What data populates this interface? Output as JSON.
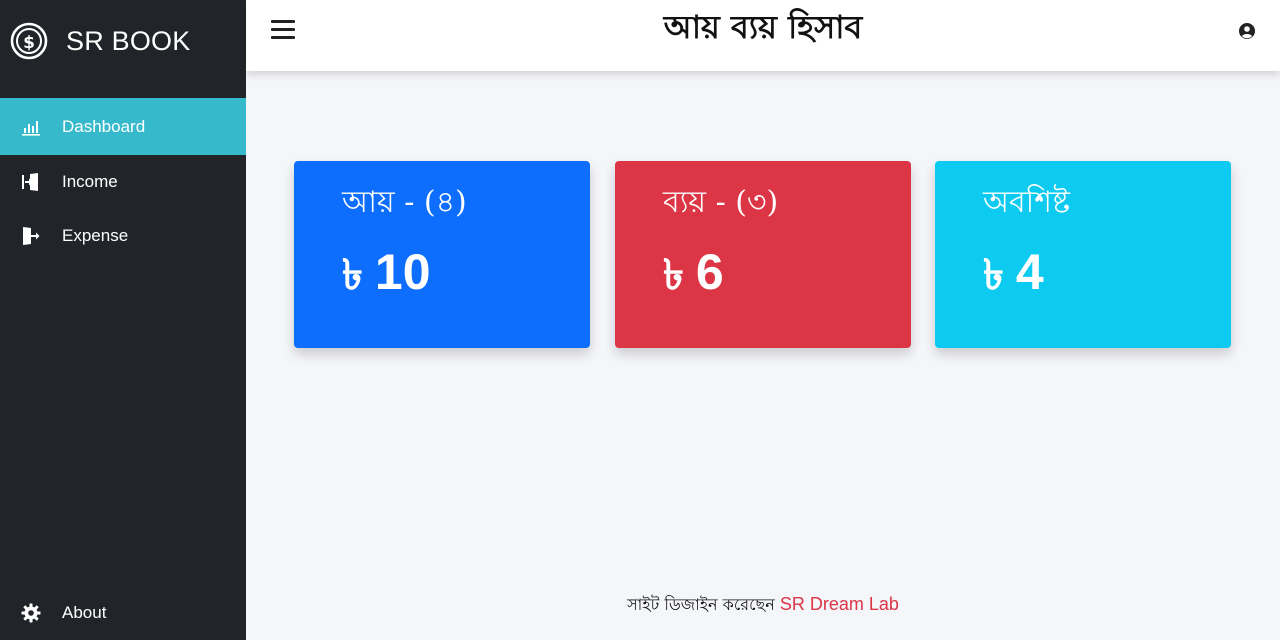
{
  "brand": {
    "name": "SR BOOK",
    "icon": "dollar-circle-icon"
  },
  "sidebar": {
    "items": [
      {
        "label": "Dashboard",
        "icon": "bar-chart-icon",
        "active": true
      },
      {
        "label": "Income",
        "icon": "door-enter-icon",
        "active": false
      },
      {
        "label": "Expense",
        "icon": "door-exit-icon",
        "active": false
      }
    ],
    "about": {
      "label": "About",
      "icon": "gear-icon"
    }
  },
  "header": {
    "title": "আয় ব্যয় হিসাব",
    "menu_icon": "hamburger-icon",
    "user_icon": "user-circle-icon"
  },
  "cards": [
    {
      "label": "আয় - (৪)",
      "currency": "৳",
      "amount": "10",
      "color": "#0d6efd"
    },
    {
      "label": "ব্যয় - (৩)",
      "currency": "৳",
      "amount": "6",
      "color": "#dc3545"
    },
    {
      "label": "অবশিষ্ট",
      "currency": "৳",
      "amount": "4",
      "color": "#0dcaf0"
    }
  ],
  "footer": {
    "text": "সাইট ডিজাইন করেছেন ",
    "credit": "SR Dream Lab",
    "credit_color": "#dc3545"
  },
  "colors": {
    "sidebar_bg": "#212529",
    "active_item_bg": "#36bacb",
    "page_bg": "#f5f6fa"
  }
}
